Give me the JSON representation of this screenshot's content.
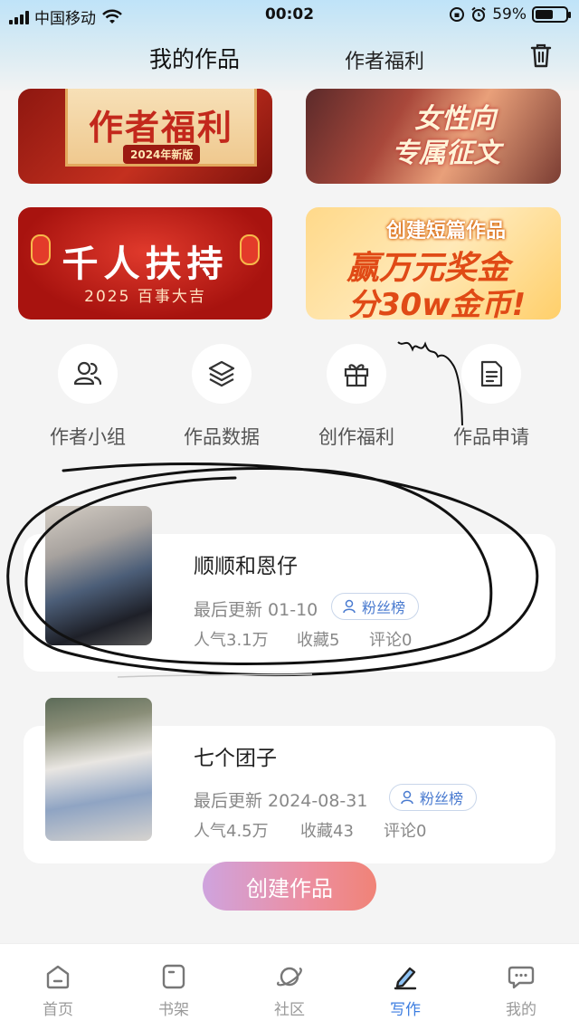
{
  "status_bar": {
    "carrier": "中国移动",
    "time": "00:02",
    "battery": "59%",
    "battery_level": 0.59
  },
  "header": {
    "tab_mine": "我的作品",
    "tab_benefit": "作者福利",
    "trash_icon": "trash-icon"
  },
  "banners": [
    {
      "line1": "作者福利",
      "tag": "2024年新版"
    },
    {
      "line1": "女性向",
      "line2": "专属征文"
    },
    {
      "line1": "千人扶持",
      "line2": "2025 百事大吉"
    },
    {
      "line1": "创建短篇作品",
      "line2": "赢万元奖金",
      "line3": "分30w金币!"
    }
  ],
  "quick_menu": [
    {
      "label": "作者小组",
      "icon": "group-icon"
    },
    {
      "label": "作品数据",
      "icon": "layers-icon"
    },
    {
      "label": "创作福利",
      "icon": "gift-icon"
    },
    {
      "label": "作品申请",
      "icon": "document-icon"
    }
  ],
  "works": [
    {
      "title": "顺顺和恩仔",
      "updated": "最后更新 01-10",
      "fan_label": "粉丝榜",
      "popularity": "人气3.1万",
      "favorites": "收藏5",
      "comments": "评论0"
    },
    {
      "title": "七个团子",
      "updated": "最后更新 2024-08-31",
      "fan_label": "粉丝榜",
      "popularity": "人气4.5万",
      "favorites": "收藏43",
      "comments": "评论0"
    }
  ],
  "create_button": "创建作品",
  "bottom_nav": [
    {
      "label": "首页",
      "icon": "home-icon"
    },
    {
      "label": "书架",
      "icon": "bookshelf-icon"
    },
    {
      "label": "社区",
      "icon": "planet-icon"
    },
    {
      "label": "写作",
      "icon": "pen-icon",
      "active": true
    },
    {
      "label": "我的",
      "icon": "chat-icon"
    }
  ],
  "colors": {
    "accent": "#3c7de0",
    "create_gradient_start": "#cfa3de",
    "create_gradient_end": "#f08377"
  }
}
